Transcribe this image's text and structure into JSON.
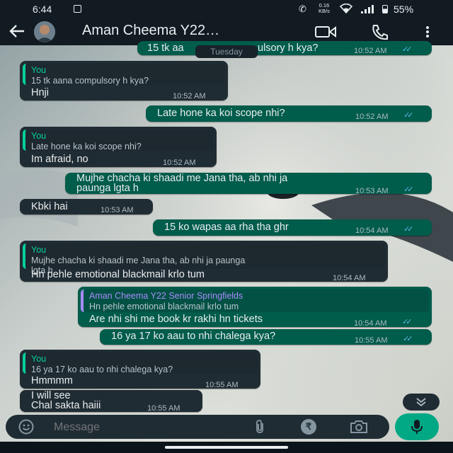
{
  "status": {
    "time": "6:44",
    "speed_value": "0.16",
    "speed_unit": "KB/s",
    "battery": "55%"
  },
  "header": {
    "contact_name": "Aman Cheema Y22…"
  },
  "date_chip": "Tuesday",
  "messages": [
    {
      "text": "15 tk aa",
      "text2": "ulsory h kya?",
      "time": "10:52 AM"
    },
    {
      "quote_author": "You",
      "quote_text": "15 tk aana compulsory h kya?",
      "text": "Hnji",
      "time": "10:52 AM"
    },
    {
      "text": "Late hone ka koi scope nhi?",
      "time": "10:52 AM"
    },
    {
      "quote_author": "You",
      "quote_text": "Late hone ka koi scope nhi?",
      "text": "Im afraid, no",
      "time": "10:52 AM"
    },
    {
      "text": "Mujhe chacha ki shaadi me Jana tha, ab nhi ja",
      "text2": "paunga lgta h",
      "time": "10:53 AM"
    },
    {
      "text": "Kbki hai",
      "time": "10:53 AM"
    },
    {
      "text": "15 ko wapas aa rha tha ghr",
      "time": "10:54 AM"
    },
    {
      "quote_author": "You",
      "quote_text": "Mujhe chacha ki shaadi me Jana tha, ab nhi ja paunga",
      "quote_text2": "lgta h",
      "text": "Hn pehle emotional blackmail krlo tum",
      "time": "10:54 AM"
    },
    {
      "quote_author": "Aman Cheema Y22 Senior Springfields",
      "quote_text": "Hn pehle emotional blackmail krlo tum",
      "text": "Are nhi shi me book kr rakhi hn tickets",
      "time": "10:54 AM"
    },
    {
      "text": "16 ya 17 ko aau to nhi chalega kya?",
      "time": "10:55 AM"
    },
    {
      "quote_author": "You",
      "quote_text": "16 ya 17 ko aau to nhi chalega kya?",
      "text": "Hmmmm",
      "time": "10:55 AM"
    },
    {
      "text": "I will see",
      "text2": "Chal sakta haiii",
      "time": "10:55 AM"
    }
  ],
  "composer": {
    "placeholder": "Message"
  },
  "colors": {
    "incoming": "#202c33",
    "outgoing": "#005c4b",
    "accent": "#00a884",
    "read_ticks": "#53bdeb"
  }
}
